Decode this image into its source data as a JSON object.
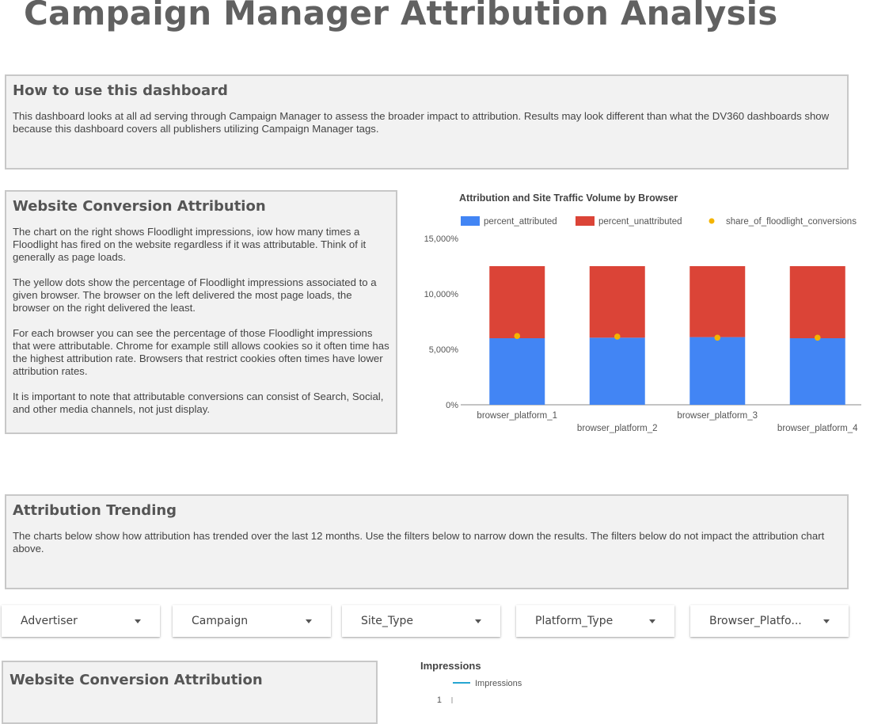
{
  "page": {
    "title": "Campaign Manager Attribution Analysis"
  },
  "howto": {
    "heading": "How to use this dashboard",
    "text": "This dashboard looks at all ad serving through Campaign Manager to assess the broader impact to attribution. Results may look different than what the DV360 dashboards show because this dashboard covers all publishers utilizing Campaign Manager tags."
  },
  "website_conversion": {
    "heading": "Website Conversion Attribution",
    "paragraphs": [
      "The chart on the right shows Floodlight impressions, iow how many times a Floodlight has fired on the website regardless if it was attributable. Think of it generally as page loads.",
      "The yellow dots show the percentage of Floodlight impressions associated to a given browser. The browser on the left delivered the most page loads, the browser on the right delivered the least.",
      "For each browser you can see the percentage of those Floodlight impressions that were attributable. Chrome for example still allows cookies so it often time has the highest attribution rate. Browsers that restrict cookies often times have lower attribution rates.",
      "It is important to note that attributable conversions can consist of Search, Social, and other media channels, not just display."
    ]
  },
  "trending": {
    "heading": "Attribution Trending",
    "text": "The charts below show how attribution has trended over the last 12 months. Use the filters below to narrow down the results. The filters below do not impact the attribution chart above."
  },
  "filters": [
    {
      "label": "Advertiser"
    },
    {
      "label": "Campaign"
    },
    {
      "label": "Site_Type"
    },
    {
      "label": "Platform_Type"
    },
    {
      "label": "Browser_Platfo..."
    }
  ],
  "website_conversion_2": {
    "heading": "Website Conversion Attribution"
  },
  "colors": {
    "attributed": "#4285f4",
    "unattributed": "#db4437",
    "share": "#f4b400",
    "impressions": "#26a6d1"
  },
  "chart_data": [
    {
      "type": "bar",
      "stacked": true,
      "title": "Attribution and Site Traffic Volume by Browser",
      "categories": [
        "browser_platform_1",
        "browser_platform_2",
        "browser_platform_3",
        "browser_platform_4"
      ],
      "series": [
        {
          "name": "percent_attributed",
          "values": [
            6000,
            6050,
            6100,
            6000
          ]
        },
        {
          "name": "percent_unattributed",
          "values": [
            6500,
            6450,
            6400,
            6500
          ]
        },
        {
          "name": "share_of_floodlight_conversions",
          "values": [
            6200,
            6150,
            6050,
            6050
          ],
          "style": "dot"
        }
      ],
      "y_ticks": [
        "0%",
        "5,000%",
        "10,000%",
        "15,000%"
      ],
      "ylim": [
        0,
        15000
      ],
      "legend": "top"
    },
    {
      "type": "line",
      "title": "Impressions",
      "series": [
        {
          "name": "Impressions",
          "values": []
        }
      ],
      "y_ticks": [
        "1"
      ],
      "legend": "top-left"
    }
  ]
}
